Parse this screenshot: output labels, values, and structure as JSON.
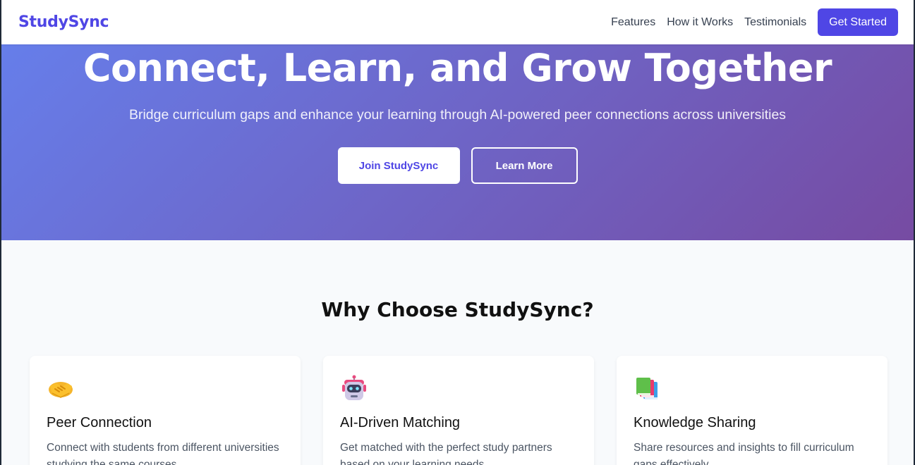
{
  "header": {
    "logo": "StudySync",
    "nav": [
      {
        "label": "Features"
      },
      {
        "label": "How it Works"
      },
      {
        "label": "Testimonials"
      }
    ],
    "cta_label": "Get Started"
  },
  "hero": {
    "title": "Connect, Learn, and Grow Together",
    "subtitle": "Bridge curriculum gaps and enhance your learning through AI-powered peer connections across universities",
    "primary_button": "Join StudySync",
    "secondary_button": "Learn More"
  },
  "features": {
    "title": "Why Choose StudySync?",
    "cards": [
      {
        "icon": "handshake-icon",
        "title": "Peer Connection",
        "description": "Connect with students from different universities studying the same courses"
      },
      {
        "icon": "robot-icon",
        "title": "AI-Driven Matching",
        "description": "Get matched with the perfect study partners based on your learning needs"
      },
      {
        "icon": "books-icon",
        "title": "Knowledge Sharing",
        "description": "Share resources and insights to fill curriculum gaps effectively"
      }
    ]
  },
  "colors": {
    "brand": "#4f46e5",
    "hero_gradient_start": "#667eea",
    "hero_gradient_end": "#764ba2",
    "section_bg": "#f8fafc"
  }
}
